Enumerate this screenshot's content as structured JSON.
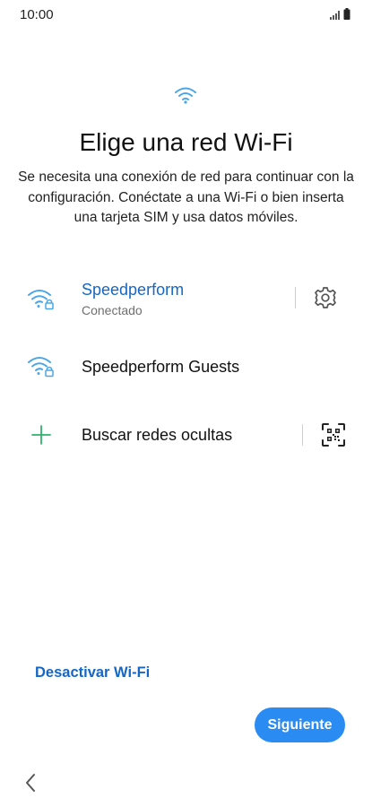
{
  "status_bar": {
    "time": "10:00"
  },
  "header": {
    "title": "Elige una red Wi-Fi",
    "subtitle": "Se necesita una conexión de red para continuar con la configuración. Conéctate a una Wi-Fi o bien inserta una tarjeta SIM y usa datos móviles."
  },
  "networks": [
    {
      "name": "Speedperform",
      "status": "Conectado",
      "icon": "wifi-lock-icon",
      "action_icon": "gear-icon"
    },
    {
      "name": "Speedperform Guests",
      "icon": "wifi-lock-icon"
    }
  ],
  "hidden_networks": {
    "label": "Buscar redes ocultas",
    "icon": "plus-icon",
    "action_icon": "qr-code-icon"
  },
  "footer": {
    "deactivate_label": "Desactivar Wi-Fi",
    "next_label": "Siguiente",
    "back_icon": "chevron-left-icon"
  },
  "colors": {
    "accent_blue": "#1467c7",
    "button_blue": "#2a8cf2",
    "wifi_icon_blue": "#4aa6e8",
    "plus_green": "#2fb36b"
  }
}
